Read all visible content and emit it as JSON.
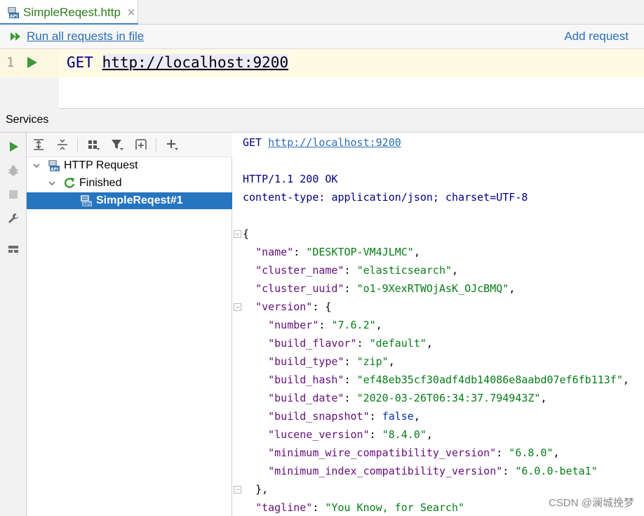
{
  "editor_tab": {
    "label": "SimpleReqest.http",
    "close": "✕"
  },
  "actions": {
    "run_all": "Run all requests in file",
    "add_request": "Add request"
  },
  "editor": {
    "line_number": "1",
    "method": "GET",
    "url": "http://localhost:9200"
  },
  "services": {
    "title": "Services",
    "tree": {
      "root": "HTTP Request",
      "group": "Finished",
      "item": "SimpleReqest#1"
    }
  },
  "response": {
    "request_method": "GET",
    "request_url": "http://localhost:9200",
    "status": "HTTP/1.1 200 OK",
    "header_name": "content-type:",
    "header_value": "application/json; charset=UTF-8",
    "open_brace": "{",
    "name_key": "\"name\"",
    "name_value": "\"DESKTOP-VM4JLMC\"",
    "cluster_name_key": "\"cluster_name\"",
    "cluster_name_value": "\"elasticsearch\"",
    "cluster_uuid_key": "\"cluster_uuid\"",
    "cluster_uuid_value": "\"o1-9XexRTWOjAsK_OJcBMQ\"",
    "version_key": "\"version\"",
    "version": {
      "number_key": "\"number\"",
      "number_value": "\"7.6.2\"",
      "build_flavor_key": "\"build_flavor\"",
      "build_flavor_value": "\"default\"",
      "build_type_key": "\"build_type\"",
      "build_type_value": "\"zip\"",
      "build_hash_key": "\"build_hash\"",
      "build_hash_value": "\"ef48eb35cf30adf4db14086e8aabd07ef6fb113f\"",
      "build_date_key": "\"build_date\"",
      "build_date_value": "\"2020-03-26T06:34:37.794943Z\"",
      "build_snapshot_key": "\"build_snapshot\"",
      "build_snapshot_value": "false",
      "lucene_version_key": "\"lucene_version\"",
      "lucene_version_value": "\"8.4.0\"",
      "min_wire_key": "\"minimum_wire_compatibility_version\"",
      "min_wire_value": "\"6.8.0\"",
      "min_index_key": "\"minimum_index_compatibility_version\"",
      "min_index_value": "\"6.0.0-beta1\""
    },
    "close_version": "},",
    "tagline_key": "\"tagline\"",
    "tagline_value": "\"You Know, for Search\""
  },
  "watermark": "CSDN @澜城挽梦",
  "colors": {
    "accent_blue": "#2675bf",
    "link_blue": "#2a6eb7",
    "run_green": "#3c9a3a",
    "json_key": "#660e7a",
    "json_string": "#067d17"
  },
  "icons": [
    "api-file-icon",
    "run-all-icon",
    "run-gutter-icon",
    "run-icon",
    "debug-icon",
    "stop-icon",
    "wrench-icon",
    "layout-icon",
    "expand-all-icon",
    "collapse-all-icon",
    "group-icon",
    "filter-icon",
    "new-tab-icon",
    "add-icon",
    "chevron-down-icon",
    "refresh-icon",
    "fold-icon"
  ]
}
